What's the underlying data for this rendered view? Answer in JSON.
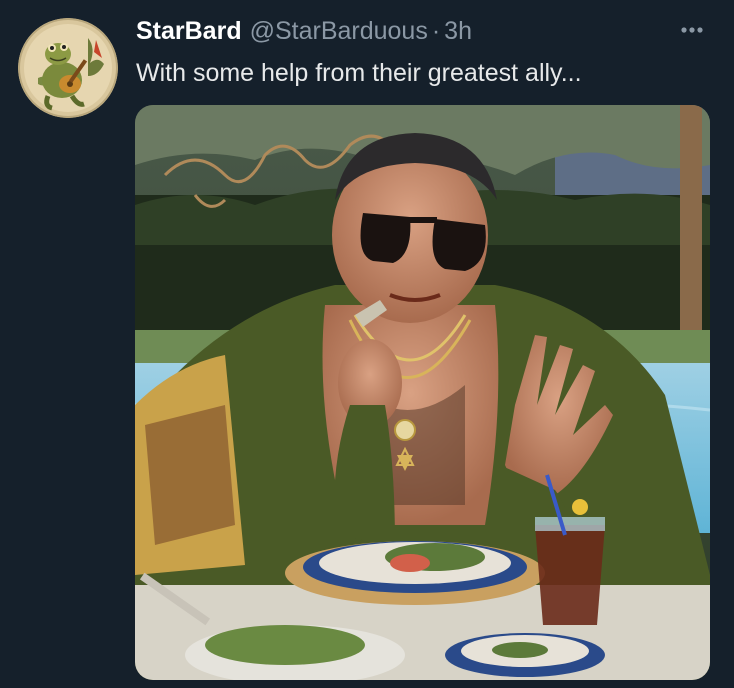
{
  "tweet": {
    "display_name": "StarBard",
    "handle": "@StarBarduous",
    "separator": "·",
    "timestamp": "3h",
    "text": "With some help from their greatest ally...",
    "more_icon": "more-horizontal-icon",
    "avatar_icon": "frog-with-guitar-avatar",
    "media_description_icon": "photo-man-sunglasses-eating-poolside"
  },
  "colors": {
    "background": "#15202b",
    "primary_text": "#e7e9ea",
    "secondary_text": "#8b98a5"
  }
}
